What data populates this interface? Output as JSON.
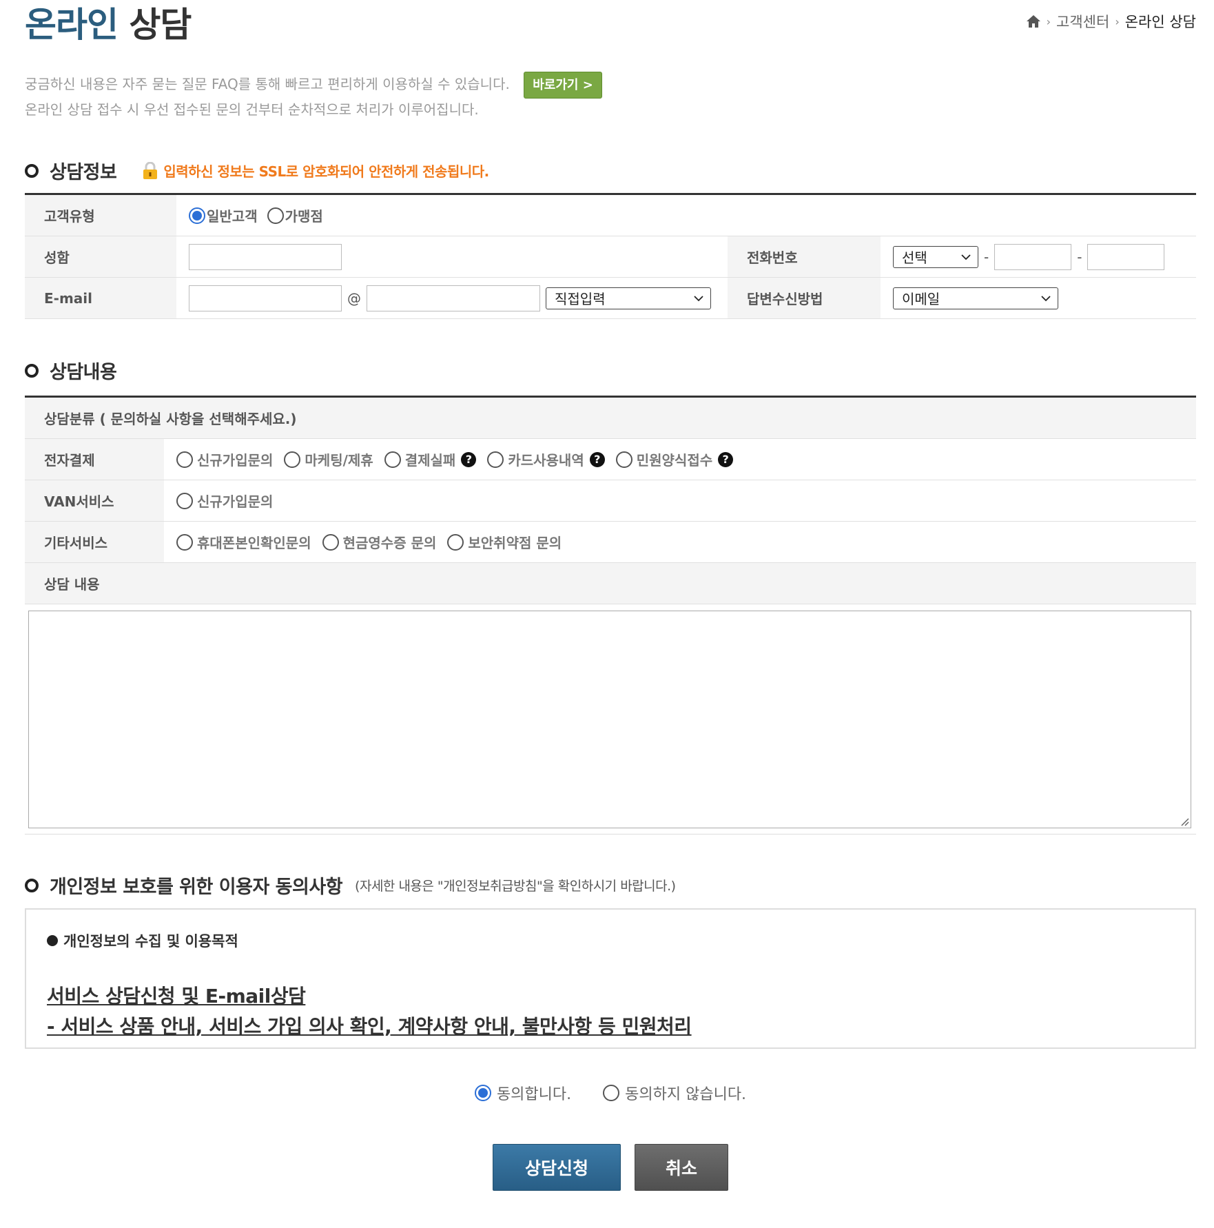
{
  "header": {
    "title_accent": "온라인",
    "title_main": "상담",
    "breadcrumb": [
      "고객센터",
      "온라인 상담"
    ]
  },
  "intro": {
    "line1": "궁금하신 내용은 자주 묻는 질문 FAQ를 통해 빠르고 편리하게 이용하실 수 있습니다.",
    "line2": "온라인 상담 접수 시 우선 접수된 문의 건부터 순차적으로 처리가 이루어집니다.",
    "faq_button": "바로가기 >"
  },
  "info_section": {
    "heading": "상담정보",
    "ssl_notice": "입력하신 정보는 SSL로 암호화되어 안전하게 전송됩니다.",
    "customer_type_label": "고객유형",
    "customer_types": [
      "일반고객",
      "가맹점"
    ],
    "customer_type_selected": "일반고객",
    "name_label": "성함",
    "name_value": "",
    "phone_label": "전화번호",
    "phone_prefix_selected": "선택",
    "phone_sep": "-",
    "email_label": "E-mail",
    "email_at": "@",
    "email_domain_selected": "직접입력",
    "reply_label": "답변수신방법",
    "reply_method_selected": "이메일"
  },
  "content_section": {
    "heading": "상담내용",
    "category_header": "상담분류 ( 문의하실 사항을 선택해주세요.)",
    "rows": [
      {
        "label": "전자결제",
        "options": [
          "신규가입문의",
          "마케팅/제휴",
          "결제실패",
          "카드사용내역",
          "민원양식접수"
        ]
      },
      {
        "label": "VAN서비스",
        "options": [
          "신규가입문의"
        ]
      },
      {
        "label": "기타서비스",
        "options": [
          "휴대폰본인확인문의",
          "현금영수증 문의",
          "보안취약점 문의"
        ]
      }
    ],
    "help_marked": [
      "결제실패",
      "카드사용내역",
      "민원양식접수"
    ],
    "content_label": "상담 내용",
    "content_value": ""
  },
  "privacy_section": {
    "heading": "개인정보 보호를 위한 이용자 동의사항",
    "note": "(자세한 내용은 \"개인정보취급방침\"을 확인하시기 바랍니다.)",
    "purpose_title": "개인정보의 수집 및 이용목적",
    "line1": "서비스 상담신청 및 E-mail상담",
    "line2": "- 서비스 상품 안내, 서비스 가입 의사 확인, 계약사항 안내, 불만사항 등 민원처리",
    "agree": "동의합니다.",
    "disagree": "동의하지 않습니다.",
    "agree_selected": "agree"
  },
  "buttons": {
    "submit": "상담신청",
    "cancel": "취소"
  },
  "colors": {
    "accent": "#2b5d7e",
    "faq_button": "#7aa843",
    "ssl_text": "#f07a1c",
    "radio_on": "#2c6fd6",
    "submit": "#2e6890",
    "cancel": "#5c5c5c"
  }
}
